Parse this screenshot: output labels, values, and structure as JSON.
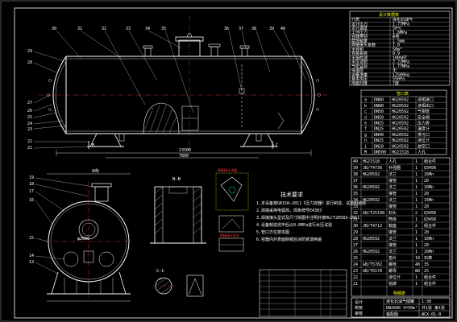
{
  "view_labels": {
    "section_aa": "A向",
    "section_bb": "B—B",
    "section_cc": "C—C",
    "cut_b": "B",
    "cut_c": "C"
  },
  "part_callouts_top": [
    "30",
    "31",
    "32",
    "33",
    "34",
    "35",
    "36",
    "37",
    "38",
    "39",
    "40"
  ],
  "part_callouts_left": [
    "29",
    "28",
    "27",
    "26",
    "25",
    "24",
    "23",
    "22",
    "21"
  ],
  "part_callouts_lower_left": [
    "19",
    "18",
    "17",
    "16",
    "15",
    "14",
    "13"
  ],
  "tech_requirements_title": "技术要求",
  "tech_requirements_lines": [
    "1.本设备按GB150—2011《压力容器》进行制造、试验和验收",
    "2.焊接采用电弧焊，焊条牌号E4303",
    "3.焊接接头型式及尺寸除图中注明外按HG/T20583—2011",
    "4.设备制造完毕后以0.6MPa进行水压试验",
    "5.管口方位按本图",
    "6.容器内外表面除锈后涂防锈漆两遍"
  ],
  "weld_detail_title": "焊接接头详图",
  "weld_note": "焊接接头型式",
  "design_table_title": "设计数据表",
  "design_table_rows": [
    [
      "介质",
      "液化石油气"
    ],
    [
      "设计压力",
      "1.77MPa"
    ],
    [
      "设计温度",
      "50℃"
    ],
    [
      "工作压力",
      "1.6MPa"
    ],
    [
      "容器类别",
      "Ⅲ类"
    ],
    [
      "腐蚀裕量",
      "1.5mm"
    ],
    [
      "焊接接头系数",
      "1.0"
    ],
    [
      "全容积",
      "50m³"
    ],
    [
      "充装系数",
      "0.9"
    ],
    [
      "无损检测",
      "100%RT"
    ],
    [
      "水压试验",
      "2.22MPa"
    ],
    [
      "气密试验",
      "1.77MPa"
    ],
    [
      "保温层",
      "无"
    ],
    [
      "设备净重",
      "12500kg"
    ],
    [
      "基本风压",
      "550Pa"
    ],
    [
      "地震烈度",
      "7度"
    ]
  ],
  "nozzle_table_title": "管口表",
  "nozzle_rows": [
    [
      "a",
      "DN80",
      "HG20592",
      "液相进口"
    ],
    [
      "b",
      "DN80",
      "HG20592",
      "液相出口"
    ],
    [
      "c",
      "DN50",
      "HG20592",
      "气相管"
    ],
    [
      "d",
      "DN50",
      "HG20592",
      "安全阀"
    ],
    [
      "e",
      "DN25",
      "HG20592",
      "压力表"
    ],
    [
      "f",
      "DN25",
      "HG20592",
      "温度计"
    ],
    [
      "g",
      "DN40",
      "HG20592",
      "排污口"
    ],
    [
      "h",
      "DN25",
      "HG20592",
      "液位计"
    ],
    [
      "i",
      "DN20",
      "HG20592",
      "放空口"
    ],
    [
      "M",
      "DN500",
      "HG21518",
      "人孔"
    ]
  ],
  "parts_list_title": "明细表",
  "parts_rows": [
    [
      "40",
      "HG21518",
      "人孔",
      "1",
      "组合件"
    ],
    [
      "39",
      "JB/T4736",
      "补强圈",
      "1",
      "Q345R"
    ],
    [
      "38",
      "HG20592",
      "法兰",
      "1",
      "16Mn"
    ],
    [
      "37",
      "",
      "接管",
      "1",
      "20"
    ],
    [
      "36",
      "HG20592",
      "法兰",
      "1",
      "16Mn"
    ],
    [
      "35",
      "",
      "接管",
      "1",
      "20"
    ],
    [
      "34",
      "HG20592",
      "法兰",
      "1",
      "16Mn"
    ],
    [
      "33",
      "",
      "接管",
      "1",
      "20"
    ],
    [
      "32",
      "GB/T25198",
      "封头",
      "2",
      "Q345R"
    ],
    [
      "31",
      "",
      "筒体",
      "1",
      "Q345R"
    ],
    [
      "30",
      "JB/T4712",
      "鞍座",
      "2",
      "组合件"
    ],
    [
      "29",
      "",
      "接管",
      "1",
      "20"
    ],
    [
      "28",
      "HG20592",
      "法兰",
      "1",
      "16Mn"
    ],
    [
      "27",
      "",
      "接管",
      "1",
      "20"
    ],
    [
      "26",
      "HG20592",
      "法兰",
      "1",
      "16Mn"
    ],
    [
      "25",
      "",
      "垫片",
      "10",
      "石棉"
    ],
    [
      "24",
      "GB/T5782",
      "螺栓",
      "40",
      "35"
    ],
    [
      "23",
      "GB/T6170",
      "螺母",
      "80",
      "25"
    ],
    [
      "22",
      "",
      "液位计",
      "1",
      "组合件"
    ],
    [
      "21",
      "",
      "铭牌",
      "1",
      "组合件"
    ]
  ],
  "title_block": {
    "drawing_name": "液化石油气储罐",
    "spec": "DN2600  V=50m³",
    "sub": "装配图",
    "drawing_no": "WCX-01-0",
    "scale": "1:30",
    "sheet": "共1张 第1张",
    "designer": "设计",
    "checker": "校核",
    "approver": "审核"
  },
  "dimensions": {
    "overall_length": "13500",
    "support_spacing": "7800",
    "dia": "φ2600"
  }
}
